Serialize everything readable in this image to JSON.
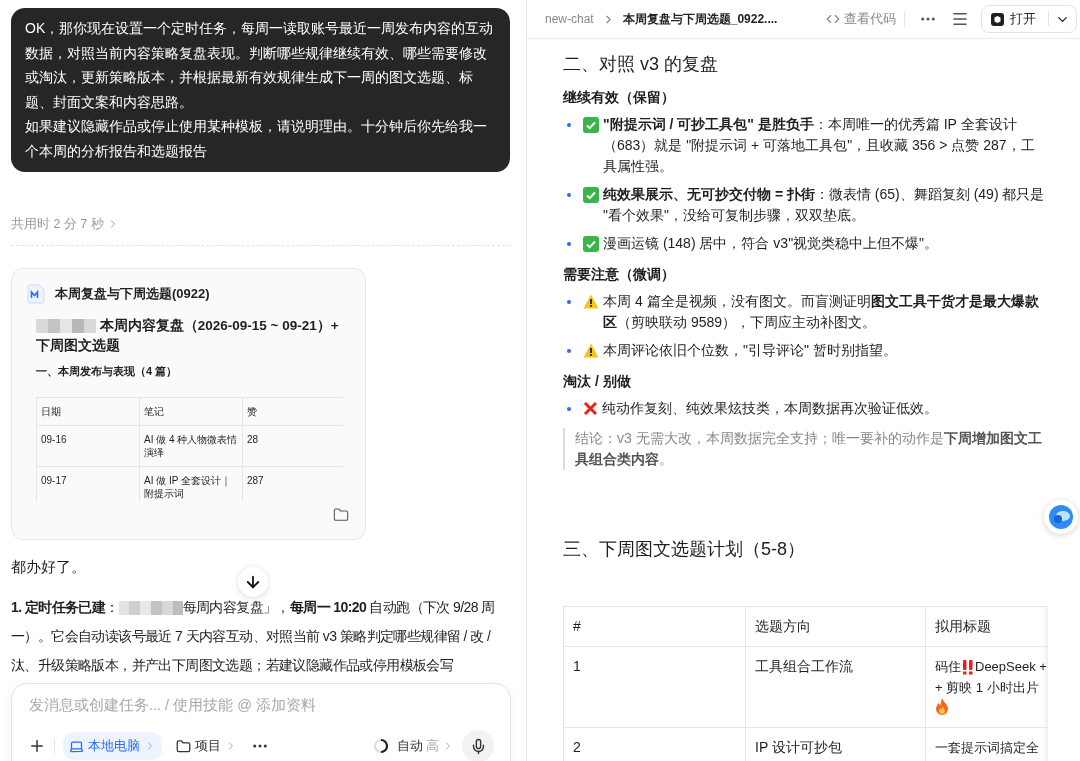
{
  "chat": {
    "user_message": {
      "paragraphs": [
        "OK，那你现在设置一个定时任务，每周一读取账号最近一周发布内容的互动数据，对照当前内容策略复盘表现。判断哪些规律继续有效、哪些需要修改或淘汰，更新策略版本，并根据最新有效规律生成下一周的图文选题、标题、封面文案和内容思路。",
        "如果建议隐藏作品或停止使用某种模板，请说明理由。十分钟后你先给我一个本周的分析报告和选题报告"
      ]
    },
    "elapsed": "共用时 2 分 7 秒",
    "file_card": {
      "file_name": "本周复盘与下周选题(0922)",
      "title_redacted": true,
      "title": "本周内容复盘（2026-09-15 ~ 09-21）+ 下周图文选题",
      "section": "一、本周发布与表现（4 篇）",
      "table": {
        "columns": [
          "日期",
          "笔记",
          "赞"
        ],
        "rows": [
          [
            "09-16",
            "AI 做 4 种人物微表情演绎",
            "28"
          ],
          [
            "09-17",
            "AI 做 IP 全套设计｜附提示词",
            "287"
          ]
        ]
      }
    },
    "reply_intro": "都办好了。",
    "reply_item": {
      "label": "**1. 定时任务已建**：",
      "redacted": true,
      "text": "每周内容复盘」，**每周一 10:20** 自动跑（下次 9/28 周一）。它会自动读该号最近 7 天内容互动、对照当前 v3 策略判定哪些规律留 / 改 / 汰、升级策略版本，并产出下周图文选题；若建议隐藏作品或停用模板会写"
    },
    "composer": {
      "placeholder": "发消息或创建任务... / 使用技能 @ 添加资料",
      "chips": [
        {
          "label": "本地电脑",
          "kind": "device",
          "selected": true
        },
        {
          "label": "项目",
          "kind": "folder",
          "selected": false
        }
      ],
      "mode": "自动",
      "level": "高"
    }
  },
  "document": {
    "breadcrumb": [
      "new-chat",
      "本周复盘与下周选题_0922...."
    ],
    "view_code": "查看代码",
    "open_button": "打开",
    "blocks": [
      {
        "kind": "h2",
        "text": "二、对照 v3 的复盘"
      },
      {
        "kind": "h4",
        "text": "继续有效（保留）"
      },
      {
        "kind": "check",
        "text": "**\"附提示词 / 可抄工具包\" 是胜负手**：本周唯一的优秀篇 IP 全套设计（683）就是 \"附提示词 + 可落地工具包\"，且收藏 356 > 点赞 287，工具属性强。"
      },
      {
        "kind": "check",
        "text": "**纯效果展示、无可抄交付物 = 扑街**：微表情 (65)、舞蹈复刻 (49) 都只是 \"看个效果\"，没给可复制步骤，双双垫底。"
      },
      {
        "kind": "check",
        "text": "漫画运镜 (148) 居中，符合 v3\"视觉类稳中上但不爆\"。"
      },
      {
        "kind": "h4",
        "text": "需要注意（微调）"
      },
      {
        "kind": "warning",
        "text": "本周 4 篇全是视频，没有图文。而盲测证明**图文工具干货才是最大爆款区**（剪映联动 9589），下周应主动补图文。"
      },
      {
        "kind": "warning",
        "text": "本周评论依旧个位数，\"引导评论\" 暂时别指望。"
      },
      {
        "kind": "h4",
        "text": "淘汰 / 别做"
      },
      {
        "kind": "cross",
        "text": "纯动作复刻、纯效果炫技类，本周数据再次验证低效。"
      },
      {
        "kind": "quote",
        "text": "结论：v3 无需大改，本周数据完全支持；唯一要补的动作是**下周增加图文工具组合类内容**。"
      },
      {
        "kind": "h2",
        "text": "三、下周图文选题计划（5-8）"
      }
    ],
    "plan_table": {
      "columns": [
        "#",
        "选题方向",
        "拟用标题"
      ],
      "rows": [
        {
          "number": "1",
          "direction": "工具组合工作流",
          "title_lines": [
            [
              {
                "kind": "text",
                "text": "码住"
              },
              {
                "kind": "alert"
              },
              {
                "kind": "text",
                "text": "DeepSeek +"
              }
            ],
            [
              {
                "kind": "text",
                "text": "+ 剪映 1 小时出片"
              }
            ],
            [
              {
                "kind": "flame"
              }
            ]
          ]
        },
        {
          "number": "2",
          "direction": "IP 设计可抄包",
          "title_lines": [
            [
              {
                "kind": "text",
                "text": "一套提示词搞定全"
              }
            ]
          ]
        }
      ]
    }
  }
}
